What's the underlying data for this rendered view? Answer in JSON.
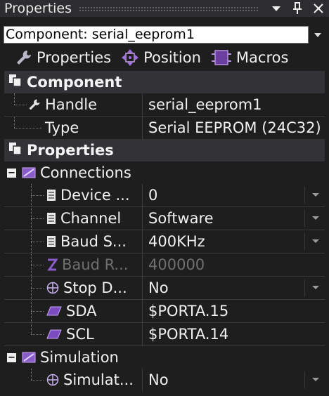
{
  "window": {
    "title": "Properties"
  },
  "component_select": {
    "value": "Component: serial_eeprom1"
  },
  "toolbar": {
    "properties_label": "Properties",
    "position_label": "Position",
    "macros_label": "Macros"
  },
  "grid": {
    "component_category": "Component",
    "handle": {
      "name": "Handle",
      "value": "serial_eeprom1"
    },
    "type": {
      "name": "Type",
      "value": "Serial EEPROM (24C32)"
    },
    "properties_category": "Properties",
    "connections": {
      "label": "Connections",
      "rows": [
        {
          "name": "Device ...",
          "value": "0"
        },
        {
          "name": "Channel",
          "value": "Software"
        },
        {
          "name": "Baud S...",
          "value": "400KHz"
        },
        {
          "name": "Baud R...",
          "value": "400000"
        },
        {
          "name": "Stop D...",
          "value": "No"
        },
        {
          "name": "SDA",
          "value": "$PORTA.15"
        },
        {
          "name": "SCL",
          "value": "$PORTA.14"
        }
      ]
    },
    "simulation": {
      "label": "Simulation",
      "rows": [
        {
          "name": "Simulat...",
          "value": "No"
        }
      ]
    }
  },
  "colors": {
    "background": "#1e1e1e",
    "category": "#333337",
    "accent_purple": "#a070e0"
  }
}
